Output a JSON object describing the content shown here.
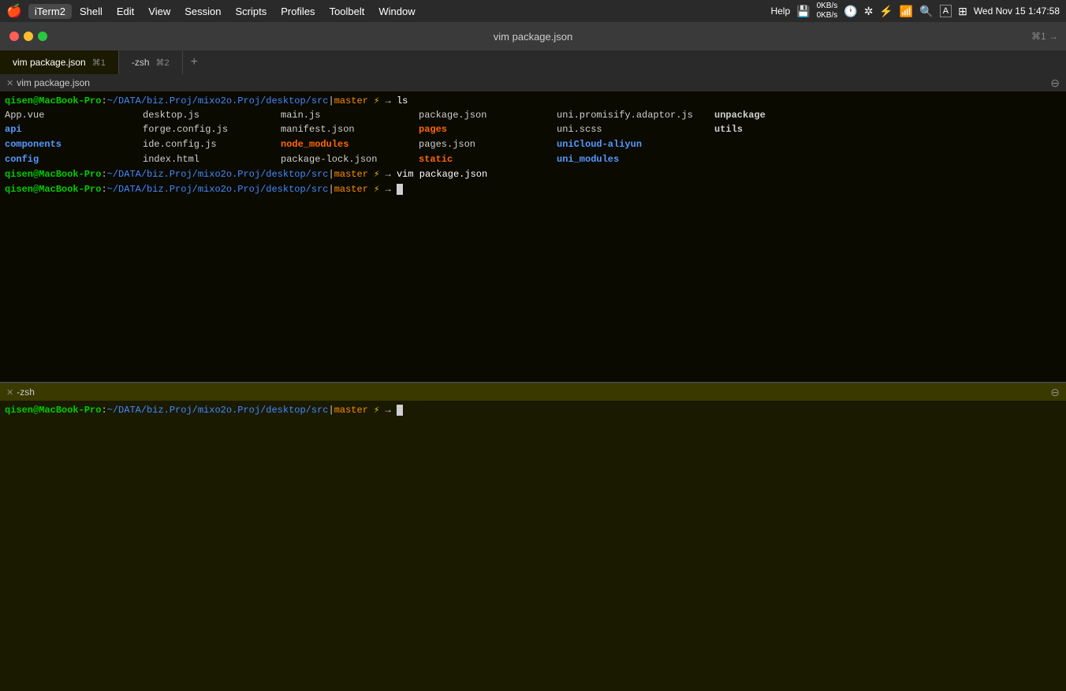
{
  "menubar": {
    "apple": "🍎",
    "app": "iTerm2",
    "items": [
      "Shell",
      "Edit",
      "View",
      "Session",
      "Scripts",
      "Profiles",
      "Toolbelt",
      "Window"
    ],
    "help": "Help",
    "network": "0KB/s\n0KB/s",
    "time_machine": "🕐",
    "bluetooth": "⌂",
    "battery": "⚡",
    "wifi": "WiFi",
    "search": "🔍",
    "keyboard": "A",
    "control_center": "≡",
    "datetime": "Wed Nov 15  1:47:58"
  },
  "titlebar": {
    "title": "vim package.json",
    "shortcut": "⌘1 →"
  },
  "tabs": [
    {
      "label": "vim package.json",
      "shortcut": "⌘1",
      "active": true
    },
    {
      "label": "-zsh",
      "shortcut": "⌘2",
      "active": false
    }
  ],
  "pane_top": {
    "title": "vim package.json",
    "prompt": {
      "user": "qisen",
      "at": "@",
      "host": "MacBook-Pro",
      "colon": ":",
      "path": "~/DATA/biz.Proj/mixo2o.Proj/desktop/src",
      "branch_sep": "|",
      "branch": "master",
      "bolt": "⚡",
      "arrow": "→",
      "command": "ls"
    },
    "ls_files": [
      {
        "name": "App.vue",
        "type": "normal"
      },
      {
        "name": "desktop.js",
        "type": "normal"
      },
      {
        "name": "main.js",
        "type": "normal"
      },
      {
        "name": "package.json",
        "type": "normal"
      },
      {
        "name": "uni.promisify.adaptor.js",
        "type": "normal"
      },
      {
        "name": "unpackage",
        "type": "bold"
      },
      {
        "name": "api",
        "type": "blue-bold"
      },
      {
        "name": "forge.config.js",
        "type": "normal"
      },
      {
        "name": "manifest.json",
        "type": "normal"
      },
      {
        "name": "pages",
        "type": "orange-bold"
      },
      {
        "name": "uni.scss",
        "type": "normal"
      },
      {
        "name": "utils",
        "type": "bold"
      },
      {
        "name": "components",
        "type": "blue-bold"
      },
      {
        "name": "ide.config.js",
        "type": "normal"
      },
      {
        "name": "node_modules",
        "type": "orange-bold"
      },
      {
        "name": "pages.json",
        "type": "normal"
      },
      {
        "name": "uniCloud-aliyun",
        "type": "blue-bold"
      },
      {
        "name": "",
        "type": "normal"
      },
      {
        "name": "config",
        "type": "blue-bold"
      },
      {
        "name": "index.html",
        "type": "normal"
      },
      {
        "name": "package-lock.json",
        "type": "normal"
      },
      {
        "name": "static",
        "type": "orange-bold"
      },
      {
        "name": "uni_modules",
        "type": "blue-bold"
      },
      {
        "name": "",
        "type": "normal"
      }
    ],
    "prompt2": {
      "command": "vim package.json"
    },
    "prompt3": {
      "command": ""
    }
  },
  "pane_bottom": {
    "title": "-zsh",
    "prompt": {
      "user": "qisen",
      "at": "@",
      "host": "MacBook-Pro",
      "colon": ":",
      "path": "~/DATA/biz.Proj/mixo2o.Proj/desktop/src",
      "branch_sep": "|",
      "branch": "master",
      "bolt": "⚡",
      "arrow": "→"
    }
  }
}
